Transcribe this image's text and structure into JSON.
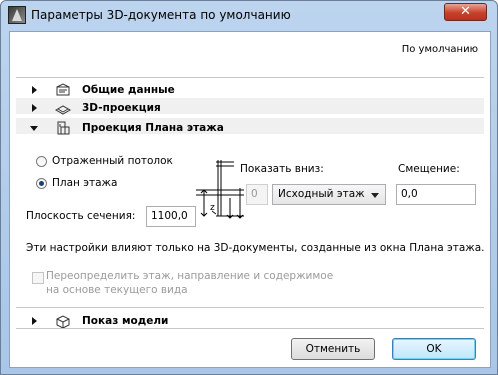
{
  "window": {
    "title": "Параметры 3D-документа по умолчанию",
    "close_glyph": "✕"
  },
  "header": {
    "default_link": "По умолчанию"
  },
  "sections": [
    {
      "title": "Общие данные",
      "expanded": false,
      "icon": "general-data-icon"
    },
    {
      "title": "3D-проекция",
      "expanded": false,
      "icon": "3d-projection-icon"
    },
    {
      "title": "Проекция Плана этажа",
      "expanded": true,
      "icon": "floor-plan-projection-icon"
    },
    {
      "title": "Показ модели",
      "expanded": false,
      "icon": "model-display-icon"
    }
  ],
  "floor_plan": {
    "radio_reflected": {
      "label": "Отраженный потолок",
      "checked": false
    },
    "radio_plan": {
      "label": "План этажа",
      "checked": true
    },
    "show_down_label": "Показать вниз:",
    "show_down_value": "0",
    "floor_select": "Исходный этаж",
    "offset_label": "Смещение:",
    "offset_value": "0,0",
    "cut_plane_label": "Плоскость сечения:",
    "cut_plane_value": "1100,0",
    "info_text": "Эти настройки влияют только на 3D-документы, созданные из окна Плана этажа.",
    "override_line1": "Переопределить этаж, направление и содержимое",
    "override_line2": "на основе текущего вида",
    "override_checked": false
  },
  "buttons": {
    "cancel": "Отменить",
    "ok": "OK"
  },
  "colors": {
    "title_bar": "#bcd4ee",
    "close_button": "#c7402a",
    "ok_button": "#bee6fd"
  }
}
